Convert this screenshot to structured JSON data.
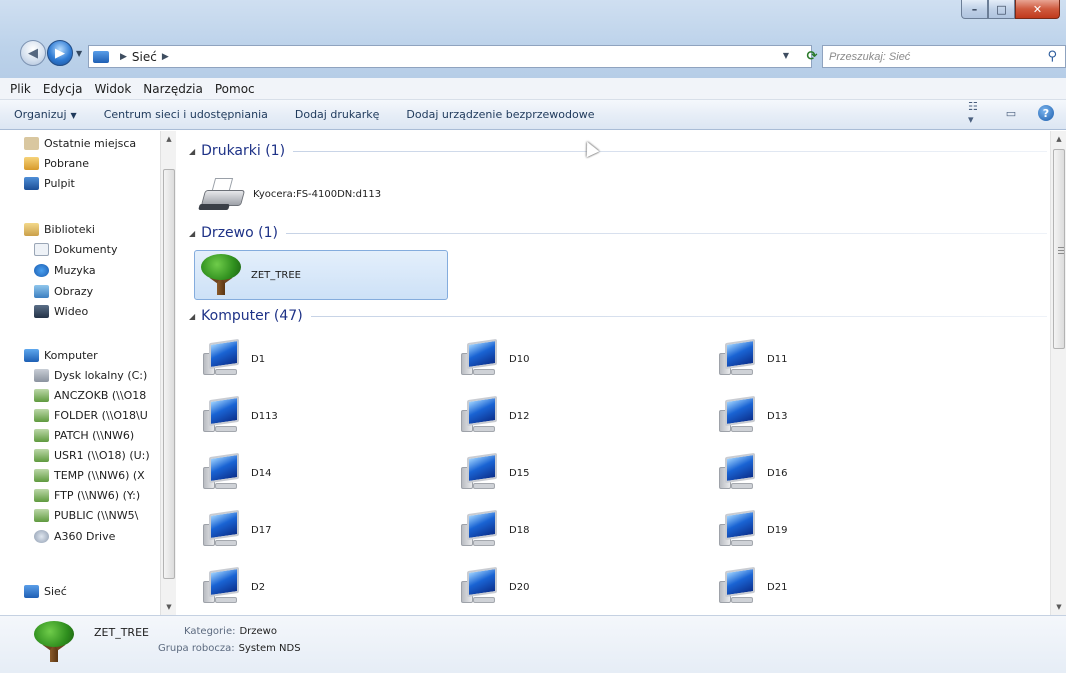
{
  "window": {
    "caption_buttons": {
      "minimize": "–",
      "maximize": "□",
      "close": "✕"
    }
  },
  "address_bar": {
    "crumbs": [
      "Sieć"
    ],
    "search_placeholder": "Przeszukaj: Sieć"
  },
  "menu": [
    "Plik",
    "Edycja",
    "Widok",
    "Narzędzia",
    "Pomoc"
  ],
  "command_bar": {
    "organize": "Organizuj",
    "items": [
      "Centrum sieci i udostępniania",
      "Dodaj drukarkę",
      "Dodaj urządzenie bezprzewodowe"
    ]
  },
  "nav_pane": {
    "items": [
      {
        "label": "Ostatnie miejsca",
        "icon": "recent-places-icon"
      },
      {
        "label": "Pobrane",
        "icon": "downloads-icon"
      },
      {
        "label": "Pulpit",
        "icon": "desktop-icon"
      },
      {
        "label": "Biblioteki",
        "icon": "libraries-icon"
      },
      {
        "label": "Dokumenty",
        "icon": "documents-icon"
      },
      {
        "label": "Muzyka",
        "icon": "music-icon"
      },
      {
        "label": "Obrazy",
        "icon": "pictures-icon"
      },
      {
        "label": "Wideo",
        "icon": "video-icon"
      },
      {
        "label": "Komputer",
        "icon": "computer-icon"
      },
      {
        "label": "Dysk lokalny (C:)",
        "icon": "local-disk-icon"
      },
      {
        "label": "ANCZOKB (\\\\O18",
        "icon": "network-drive-icon"
      },
      {
        "label": "FOLDER (\\\\O18\\U",
        "icon": "network-drive-icon"
      },
      {
        "label": "PATCH (\\\\NW6)",
        "icon": "network-drive-icon"
      },
      {
        "label": "USR1 (\\\\O18) (U:)",
        "icon": "network-drive-icon"
      },
      {
        "label": "TEMP (\\\\NW6) (X",
        "icon": "network-drive-icon"
      },
      {
        "label": "FTP (\\\\NW6) (Y:)",
        "icon": "network-drive-icon"
      },
      {
        "label": "PUBLIC (\\\\NW5\\",
        "icon": "network-drive-icon"
      },
      {
        "label": "A360 Drive",
        "icon": "cloud-drive-icon"
      },
      {
        "label": "Sieć",
        "icon": "network-icon"
      }
    ]
  },
  "groups": {
    "printers": {
      "title": "Drukarki (1)",
      "items": [
        "Kyocera:FS-4100DN:d113"
      ]
    },
    "tree": {
      "title": "Drzewo (1)",
      "items": [
        "ZET_TREE"
      ]
    },
    "computers": {
      "title": "Komputer (47)",
      "items": [
        "D1",
        "D10",
        "D11",
        "D113",
        "D12",
        "D13",
        "D14",
        "D15",
        "D16",
        "D17",
        "D18",
        "D19",
        "D2",
        "D20",
        "D21"
      ]
    }
  },
  "details": {
    "name": "ZET_TREE",
    "category_label": "Kategorie:",
    "category_value": "Drzewo",
    "workgroup_label": "Grupa robocza:",
    "workgroup_value": "System NDS"
  },
  "colors": {
    "group_title": "#1e3287",
    "selection": "#cde1f7",
    "selection_border": "#84acdd"
  }
}
